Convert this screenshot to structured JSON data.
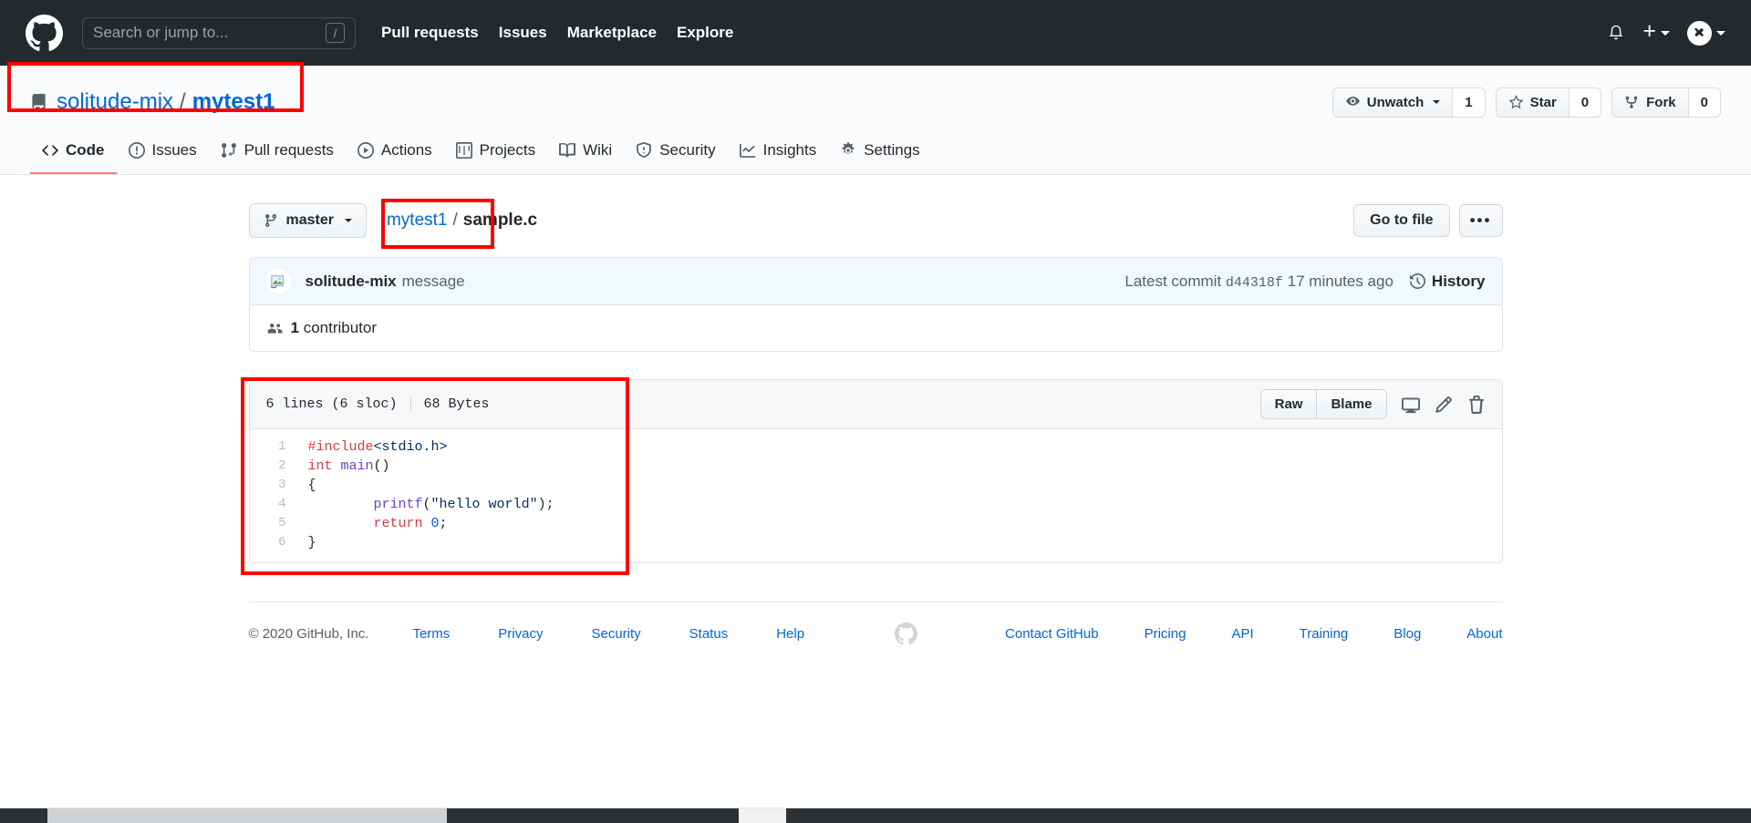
{
  "header": {
    "logo_icon": "github-mark-icon",
    "search": {
      "placeholder": "Search or jump to...",
      "value": "",
      "shortcut_key": "/"
    },
    "nav": [
      {
        "label": "Pull requests"
      },
      {
        "label": "Issues"
      },
      {
        "label": "Marketplace"
      },
      {
        "label": "Explore"
      }
    ],
    "notifications_icon": "bell-icon",
    "create_new": {
      "glyph": "+",
      "icon": "plus-icon",
      "caret": "chevron-down-icon"
    },
    "account": {
      "icon": "avatar",
      "caret": "chevron-down-icon"
    }
  },
  "repo": {
    "icon": "repo-book-icon",
    "owner": "solitude-mix",
    "separator": "/",
    "name": "mytest1",
    "actions": {
      "watch": {
        "label": "Unwatch",
        "count": "1",
        "icon": "eye-icon"
      },
      "star": {
        "label": "Star",
        "count": "0",
        "icon": "star-icon"
      },
      "fork": {
        "label": "Fork",
        "count": "0",
        "icon": "fork-icon"
      }
    },
    "tabs": [
      {
        "label": "Code",
        "icon": "code-icon",
        "active": true
      },
      {
        "label": "Issues",
        "icon": "issue-opened-icon",
        "active": false
      },
      {
        "label": "Pull requests",
        "icon": "git-pull-request-icon",
        "active": false
      },
      {
        "label": "Actions",
        "icon": "play-icon",
        "active": false
      },
      {
        "label": "Projects",
        "icon": "project-board-icon",
        "active": false
      },
      {
        "label": "Wiki",
        "icon": "book-icon",
        "active": false
      },
      {
        "label": "Security",
        "icon": "shield-icon",
        "active": false
      },
      {
        "label": "Insights",
        "icon": "graph-icon",
        "active": false
      },
      {
        "label": "Settings",
        "icon": "gear-icon",
        "active": false
      }
    ]
  },
  "file_nav": {
    "branch": {
      "label": "master",
      "icon": "git-branch-icon",
      "caret": "chevron-down-icon"
    },
    "breadcrumb": {
      "root": "mytest1",
      "separator": "/",
      "filename": "sample.c"
    },
    "go_to_file": "Go to file",
    "more_options": "•••"
  },
  "commit": {
    "author": "solitude-mix",
    "message": "message",
    "latest_commit_label": "Latest commit",
    "sha": "d44318f",
    "time": "17 minutes ago",
    "history_label": "History",
    "history_icon": "history-clock-icon",
    "contributors_icon": "people-icon",
    "contributors_count": "1",
    "contributors_label": "contributor"
  },
  "blob": {
    "lines_label": "6 lines (6 sloc)",
    "size_label": "68 Bytes",
    "raw_label": "Raw",
    "blame_label": "Blame",
    "open_desktop_icon": "desktop-download-icon",
    "edit_icon": "pencil-icon",
    "delete_icon": "trash-icon",
    "code_lines": [
      {
        "number": "1",
        "tokens": [
          {
            "text": "#include",
            "type": "pp"
          },
          {
            "text": "<stdio.h>",
            "type": "str"
          }
        ]
      },
      {
        "number": "2",
        "tokens": [
          {
            "text": "int ",
            "type": "kw"
          },
          {
            "text": "main",
            "type": "fn"
          },
          {
            "text": "()",
            "type": "plain"
          }
        ]
      },
      {
        "number": "3",
        "tokens": [
          {
            "text": "{",
            "type": "plain"
          }
        ]
      },
      {
        "number": "4",
        "tokens": [
          {
            "text": "        ",
            "type": "plain"
          },
          {
            "text": "printf",
            "type": "fn"
          },
          {
            "text": "(",
            "type": "plain"
          },
          {
            "text": "\"hello world\"",
            "type": "str"
          },
          {
            "text": ");",
            "type": "plain"
          }
        ]
      },
      {
        "number": "5",
        "tokens": [
          {
            "text": "        ",
            "type": "plain"
          },
          {
            "text": "return ",
            "type": "kw"
          },
          {
            "text": "0",
            "type": "num"
          },
          {
            "text": ";",
            "type": "plain"
          }
        ]
      },
      {
        "number": "6",
        "tokens": [
          {
            "text": "}",
            "type": "plain"
          }
        ]
      }
    ]
  },
  "footer": {
    "copyright": "© 2020 GitHub, Inc.",
    "left_links": [
      {
        "label": "Terms"
      },
      {
        "label": "Privacy"
      },
      {
        "label": "Security"
      },
      {
        "label": "Status"
      },
      {
        "label": "Help"
      }
    ],
    "mark_icon": "github-mark-icon",
    "right_links": [
      {
        "label": "Contact GitHub"
      },
      {
        "label": "Pricing"
      },
      {
        "label": "API"
      },
      {
        "label": "Training"
      },
      {
        "label": "Blog"
      },
      {
        "label": "About"
      }
    ]
  },
  "annotations": {
    "color": "#ff0000",
    "boxes": [
      {
        "name": "repo-title-highlight"
      },
      {
        "name": "file-breadcrumb-highlight"
      },
      {
        "name": "code-block-highlight"
      }
    ]
  }
}
